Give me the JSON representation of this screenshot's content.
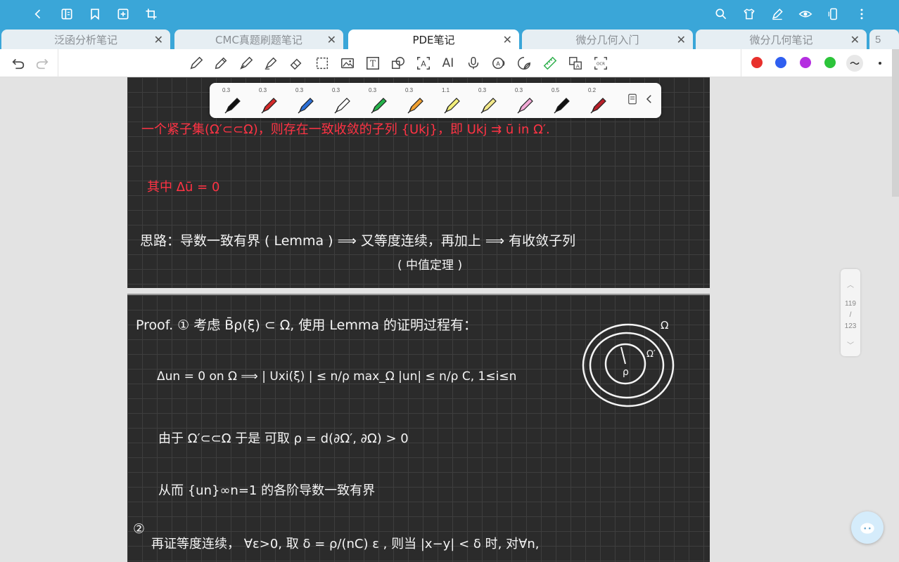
{
  "appbar": {
    "icons": [
      "back-icon",
      "sidebar-book-icon",
      "bookmark-icon",
      "add-page-icon",
      "crop-icon",
      "search-icon",
      "shirt-theme-icon",
      "pen-edit-icon",
      "eye-icon",
      "phone-rotate-icon",
      "more-vert-icon"
    ]
  },
  "tabs": [
    {
      "label": "泛函分析笔记",
      "active": false
    },
    {
      "label": "CMC真题刷题笔记",
      "active": false
    },
    {
      "label": "PDE笔记",
      "active": true
    },
    {
      "label": "微分几何入门",
      "active": false
    },
    {
      "label": "微分几何笔记",
      "active": false
    }
  ],
  "tab_count": "5",
  "toolbar": {
    "text_tool_label": "T",
    "ai_label": "AI",
    "ocr_label": "OCR",
    "colors": [
      "#e8302c",
      "#2f5ff0",
      "#b42ee0",
      "#2cc43a"
    ]
  },
  "pens": [
    {
      "size": "0.3",
      "color": "#111111"
    },
    {
      "size": "0.3",
      "color": "#d42a2a"
    },
    {
      "size": "0.3",
      "color": "#2c6fd6"
    },
    {
      "size": "0.3",
      "color": "#ffffff"
    },
    {
      "size": "0.3",
      "color": "#25b24a"
    },
    {
      "size": "0.3",
      "color": "#f0a030"
    },
    {
      "size": "1.1",
      "color": "#f2ef7a"
    },
    {
      "size": "0.3",
      "color": "#f3e98a"
    },
    {
      "size": "0.3",
      "color": "#f2a9d6"
    },
    {
      "size": "0.5",
      "color": "#111111"
    },
    {
      "size": "0.2",
      "color": "#b8202a"
    }
  ],
  "page1": {
    "line_red_1": "一个紧子集(Ω′⊂⊂Ω)，则存在一致收敛的子列 {Ukj}，即 Ukj ⇉ ū  in  Ω′.",
    "line_red_2": "其中 Δū = 0",
    "line_white_1": "思路：导数一致有界 ( Lemma ) ⟹ 又等度连续，再加上  ⟹  有收敛子列",
    "line_white_2": "( 中值定理 )"
  },
  "page2": {
    "step1_marker": "①",
    "proof_line": "Proof. ① 考虑 B̄ρ(ξ) ⊂ Ω,   使用 Lemma 的证明过程有：",
    "eq_line": "Δun = 0   on  Ω  ⟹   | Uxi(ξ) | ≤ n/ρ  max_Ω |un|  ≤ n/ρ C,  1≤i≤n",
    "since_line": "由于  Ω′⊂⊂Ω    于是  可取  ρ = d(∂Ω′, ∂Ω) > 0",
    "thus_line": "从而  {un}∞n=1   的各阶导数一致有界",
    "step2_marker": "②",
    "step2_line": "再证等度连续，  ∀ε>0,    取 δ = ρ/(nC) ε ,   则当 |x−y| < δ 时,  对∀n,",
    "diagram_omega": "Ω",
    "diagram_omega_prime": "Ω′",
    "diagram_rho": "ρ"
  },
  "pager": {
    "current": "119",
    "slash": "/",
    "total": "123"
  }
}
